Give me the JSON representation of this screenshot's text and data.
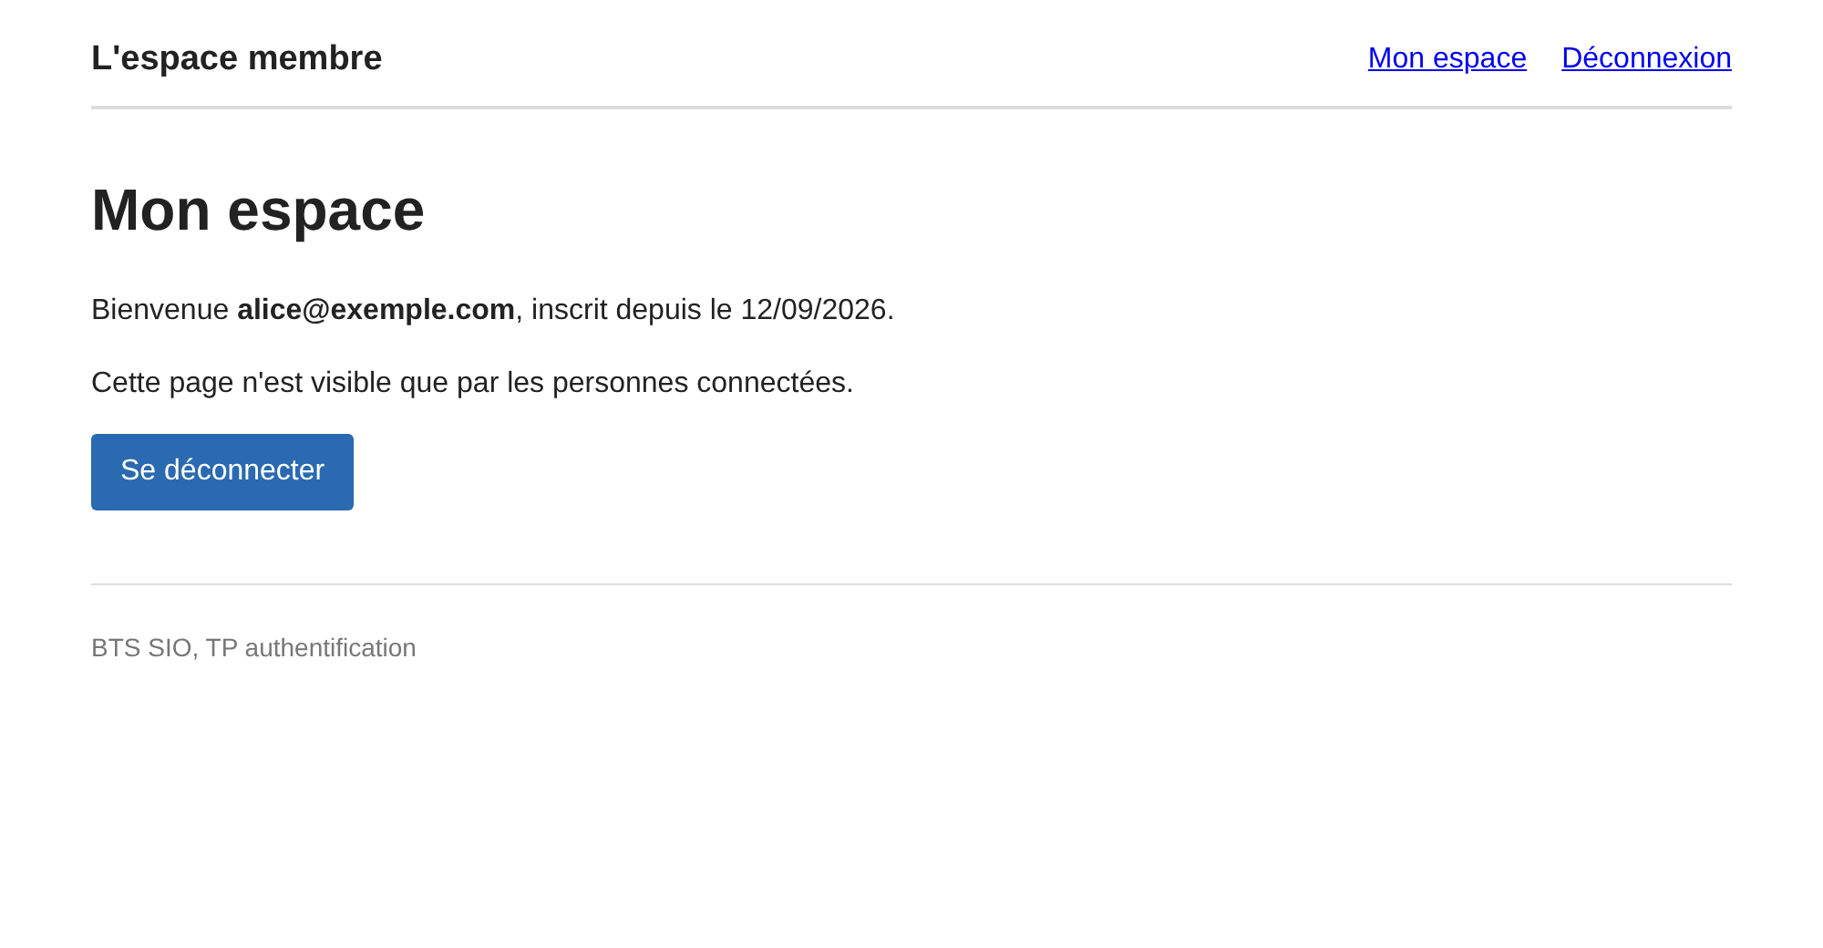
{
  "header": {
    "title": "L'espace membre",
    "links": [
      "Mon espace",
      "Déconnexion"
    ]
  },
  "main": {
    "heading": "Mon espace",
    "paragraphs": [
      "Bienvenue **alice@exemple.com**, inscrit depuis le 12/09/2026.",
      "Cette page n'est visible que par les personnes connectées."
    ],
    "button": "Se déconnecter"
  },
  "footer": {
    "text": "BTS SIO, TP authentification"
  }
}
